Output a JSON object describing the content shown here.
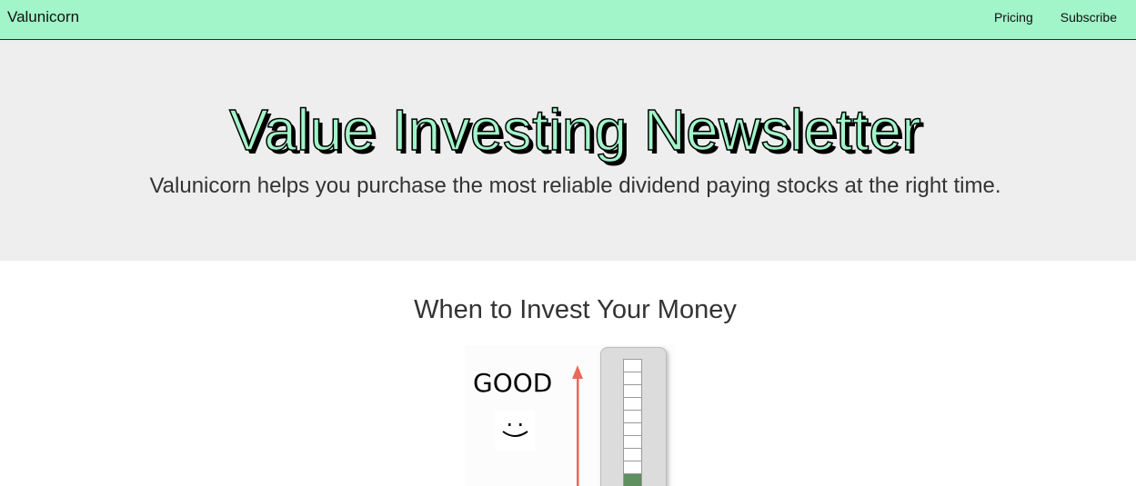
{
  "navbar": {
    "brand": "Valunicorn",
    "links": [
      "Pricing",
      "Subscribe"
    ]
  },
  "hero": {
    "title": "Value Investing Newsletter",
    "subtitle": "Valunicorn helps you purchase the most reliable dividend paying stocks at the right time."
  },
  "section": {
    "title": "When to Invest Your Money"
  },
  "meter": {
    "status_label": "GOOD",
    "face_icon": "smiley-face-icon",
    "arrow_icon": "up-arrow-icon",
    "level": 1,
    "segments": 10
  },
  "colors": {
    "brand_mint": "#a2f4c9",
    "hero_bg": "#eeeeee",
    "arrow": "#e96a5c",
    "meter_fill": "#5f8f5f"
  }
}
